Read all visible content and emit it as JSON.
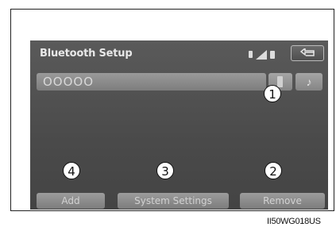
{
  "screen": {
    "title": "Bluetooth Setup",
    "device_name": "OOOOO",
    "music_glyph": "♪",
    "icons": [
      "phone-icon",
      "signal-icon",
      "battery-icon",
      "back-icon",
      "music-icon"
    ]
  },
  "buttons": {
    "add": "Add",
    "system_settings": "System Settings",
    "remove": "Remove"
  },
  "callouts": {
    "c1": "1",
    "c2": "2",
    "c3": "3",
    "c4": "4"
  },
  "figure_code": "II50WG018US"
}
